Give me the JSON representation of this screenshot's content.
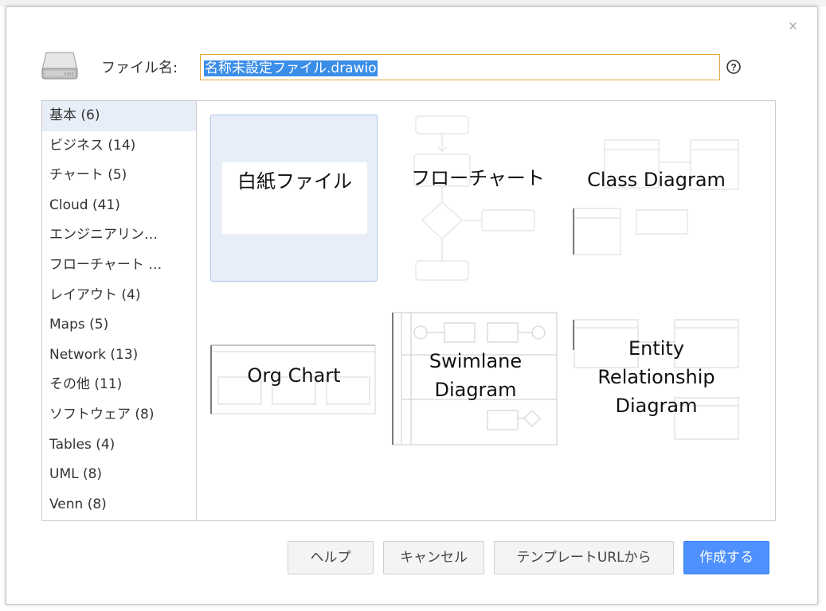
{
  "dialog": {
    "close_glyph": "×",
    "filename_label": "ファイル名:",
    "filename_value": "名称未設定ファイル.drawio",
    "help_glyph": "?"
  },
  "categories": [
    {
      "label": "基本 (6)",
      "active": true
    },
    {
      "label": "ビジネス (14)",
      "active": false
    },
    {
      "label": "チャート (5)",
      "active": false
    },
    {
      "label": "Cloud (41)",
      "active": false
    },
    {
      "label": "エンジニアリン…",
      "active": false
    },
    {
      "label": "フローチャート …",
      "active": false
    },
    {
      "label": "レイアウト (4)",
      "active": false
    },
    {
      "label": "Maps (5)",
      "active": false
    },
    {
      "label": "Network (13)",
      "active": false
    },
    {
      "label": "その他 (11)",
      "active": false
    },
    {
      "label": "ソフトウェア (8)",
      "active": false
    },
    {
      "label": "Tables (4)",
      "active": false
    },
    {
      "label": "UML (8)",
      "active": false
    },
    {
      "label": "Venn (8)",
      "active": false
    }
  ],
  "templates": [
    {
      "label": "白紙ファイル",
      "selected": true
    },
    {
      "label": "フローチャート",
      "selected": false
    },
    {
      "label": "Class Diagram",
      "selected": false
    },
    {
      "label": "Org Chart",
      "selected": false
    },
    {
      "label": "Swimlane Diagram",
      "selected": false
    },
    {
      "label": "Entity Relationship Diagram",
      "selected": false
    }
  ],
  "buttons": {
    "help": "ヘルプ",
    "cancel": "キャンセル",
    "from_url": "テンプレートURLから",
    "create": "作成する"
  },
  "colors": {
    "accent": "#4d90fe",
    "selection": "#e8eef8",
    "input_border": "#e0a63a"
  }
}
